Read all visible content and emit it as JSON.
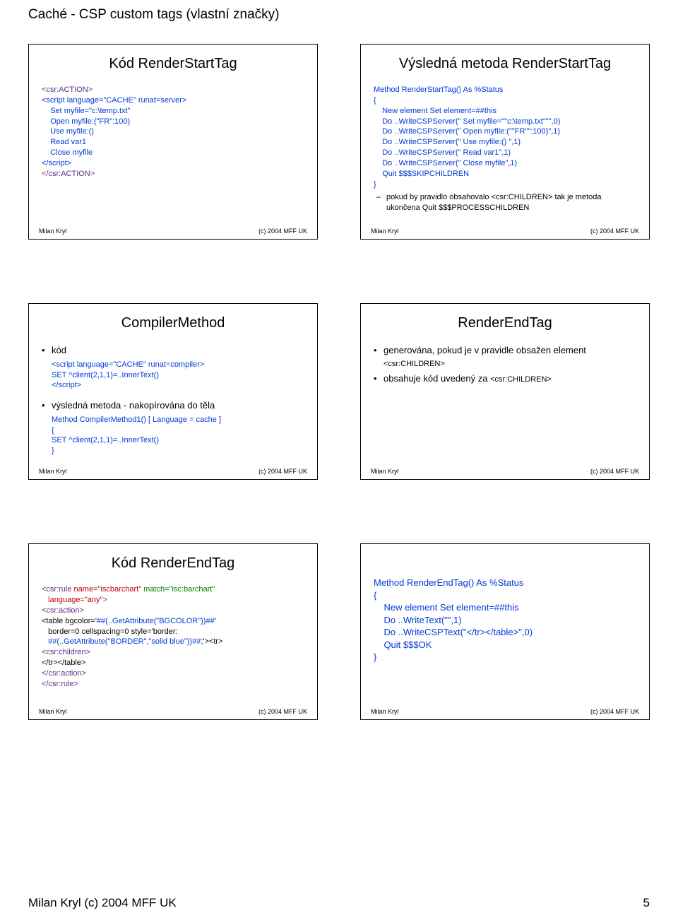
{
  "doc_title": "Caché - CSP custom tags (vlastní značky)",
  "footer_left": "Milan Kryl (c) 2004 MFF UK",
  "footer_right": "5",
  "slide_footer_left": "Milan Kryl",
  "slide_footer_right": "(c) 2004 MFF UK",
  "slides": {
    "s1": {
      "title": "Kód RenderStartTag",
      "lines": [
        {
          "cls": "purple",
          "ind": 0,
          "t": "<csr:ACTION>"
        },
        {
          "cls": "blue",
          "ind": 0,
          "t": "<script language=\"CACHE\" runat=server>"
        },
        {
          "cls": "blue",
          "ind": 1,
          "t": "Set myfile=\"c:\\temp.txt\""
        },
        {
          "cls": "blue",
          "ind": 1,
          "t": "Open myfile:(\"FR\":100)"
        },
        {
          "cls": "blue",
          "ind": 1,
          "t": "Use myfile:()"
        },
        {
          "cls": "blue",
          "ind": 1,
          "t": "Read var1"
        },
        {
          "cls": "blue",
          "ind": 1,
          "t": "Close myfile"
        },
        {
          "cls": "blue",
          "ind": 0,
          "t": "</script>"
        },
        {
          "cls": "purple",
          "ind": 0,
          "t": "</csr:ACTION>"
        }
      ]
    },
    "s2": {
      "title": "Výsledná metoda RenderStartTag",
      "lines": [
        {
          "cls": "blue",
          "ind": 0,
          "t": "Method RenderStartTag() As %Status"
        },
        {
          "cls": "blue",
          "ind": 0,
          "t": "{"
        },
        {
          "cls": "blue",
          "ind": 1,
          "t": "New element Set element=##this"
        },
        {
          "cls": "blue",
          "ind": 1,
          "t": "Do ..WriteCSPServer(\" Set myfile=\"\"c:\\temp.txt\"\"\",0)"
        },
        {
          "cls": "blue",
          "ind": 1,
          "t": "Do ..WriteCSPServer(\" Open myfile:(\"\"FR\"\":100)\",1)"
        },
        {
          "cls": "blue",
          "ind": 1,
          "t": "Do ..WriteCSPServer(\" Use myfile:() \",1)"
        },
        {
          "cls": "blue",
          "ind": 1,
          "t": "Do ..WriteCSPServer(\" Read var1\",1)"
        },
        {
          "cls": "blue",
          "ind": 1,
          "t": "Do ..WriteCSPServer(\" Close myfile\",1)"
        },
        {
          "cls": "blue",
          "ind": 1,
          "t": "Quit $$$SKIPCHILDREN"
        },
        {
          "cls": "blue",
          "ind": 0,
          "t": "}"
        }
      ],
      "note": "pokud by pravidlo obsahovalo <csr:CHILDREN> tak je metoda ukončena Quit $$$PROCESSCHILDREN"
    },
    "s3": {
      "title": "CompilerMethod",
      "bullet1": "kód",
      "lines1": [
        {
          "cls": "blue",
          "ind": 0,
          "t": "<script language=\"CACHE\" runat=compiler>"
        },
        {
          "cls": "blue",
          "ind": 0,
          "t": "SET ^client(2,1,1)=..InnerText()"
        },
        {
          "cls": "blue",
          "ind": 0,
          "t": "</script>"
        }
      ],
      "bullet2": "výsledná metoda - nakopírována do těla",
      "lines2": [
        {
          "cls": "blue",
          "ind": 0,
          "t": "Method CompilerMethod1() [ Language = cache ]"
        },
        {
          "cls": "blue",
          "ind": 0,
          "t": "{"
        },
        {
          "cls": "blue",
          "ind": 0,
          "t": "SET ^client(2,1,1)=..InnerText()"
        },
        {
          "cls": "blue",
          "ind": 0,
          "t": "}"
        }
      ]
    },
    "s4": {
      "title": "RenderEndTag",
      "b1_pre": "generována, pokud je v pravidle obsažen element ",
      "b1_tag": "<csr:CHILDREN>",
      "b2_pre": "obsahuje kód uvedený za ",
      "b2_tag": "<csr:CHILDREN>"
    },
    "s5": {
      "title": "Kód RenderEndTag",
      "lines": [
        {
          "parts": [
            {
              "cls": "purple",
              "t": "<csr:rule "
            },
            {
              "cls": "red",
              "t": "name=\"iscbarchart\" "
            },
            {
              "cls": "green",
              "t": "match=\"isc:barchart\""
            }
          ]
        },
        {
          "parts": [
            {
              "cls": "purple",
              "t": "   "
            },
            {
              "cls": "red",
              "t": "language=\"any\""
            },
            {
              "cls": "purple",
              "t": ">"
            }
          ]
        },
        {
          "parts": [
            {
              "cls": "purple",
              "t": "<csr:action>"
            }
          ]
        },
        {
          "parts": [
            {
              "cls": "black",
              "t": "<table bgcolor='"
            },
            {
              "cls": "blue",
              "t": "##(..GetAttribute(\"BGCOLOR\"))##"
            },
            {
              "cls": "black",
              "t": "'"
            }
          ]
        },
        {
          "parts": [
            {
              "cls": "black",
              "t": "   border=0 cellspacing=0 style='border:"
            }
          ]
        },
        {
          "parts": [
            {
              "cls": "black",
              "t": "   "
            },
            {
              "cls": "blue",
              "t": "##(..GetAttribute(\"BORDER\",\"solid blue\"))##"
            },
            {
              "cls": "black",
              "t": ";'><tr>"
            }
          ]
        },
        {
          "parts": [
            {
              "cls": "purple",
              "t": "<csr:children>"
            }
          ]
        },
        {
          "parts": [
            {
              "cls": "black",
              "t": "</tr></table>"
            }
          ]
        },
        {
          "parts": [
            {
              "cls": "purple",
              "t": "</csr:action>"
            }
          ]
        },
        {
          "parts": [
            {
              "cls": "purple",
              "t": "</csr:rule>"
            }
          ]
        }
      ]
    },
    "s6": {
      "title": "",
      "lines": [
        {
          "cls": "blue",
          "ind": 0,
          "t": "Method RenderEndTag() As %Status"
        },
        {
          "cls": "blue",
          "ind": 0,
          "t": "{"
        },
        {
          "cls": "blue",
          "ind": 1,
          "t": "New element Set element=##this"
        },
        {
          "cls": "blue",
          "ind": 1,
          "t": "Do ..WriteText(\"\",1)"
        },
        {
          "cls": "blue",
          "ind": 1,
          "t": "Do ..WriteCSPText(\"</tr></table>\",0)"
        },
        {
          "cls": "blue",
          "ind": 1,
          "t": "Quit $$$OK"
        },
        {
          "cls": "blue",
          "ind": 0,
          "t": "}"
        }
      ]
    }
  }
}
